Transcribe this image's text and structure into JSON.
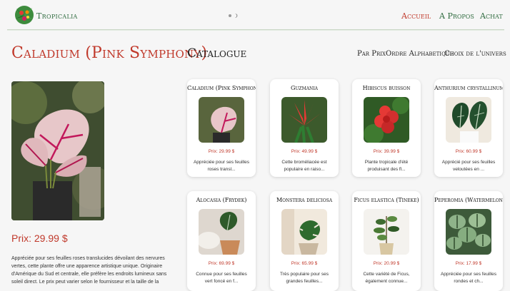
{
  "header": {
    "brand": "Tropicalia",
    "nav": [
      "Accueil",
      "A Propos",
      "Achat"
    ]
  },
  "product": {
    "title": "Caladium (Pink Symphony)",
    "price": "Prix: 29.99 $",
    "description": "Appréciée pour ses feuilles roses translucides dévoilant des nervures vertes, cette plante offre une apparence artistique unique. Originaire d'Amérique du Sud et centrale, elle préfère les endroits lumineux sans soleil direct. Le prix peut varier selon le fournisseur et la taille de la"
  },
  "catalogue": {
    "title": "Catalogue",
    "sort": [
      "Par Prix",
      "Ordre Alphabetique",
      "Choix de l'univers"
    ],
    "cards": [
      {
        "name": "Caladium (Pink Symphony)",
        "price": "Prix: 29.99 $",
        "desc1": "Appréciée pour ses feuilles",
        "desc2": "roses transl..."
      },
      {
        "name": "Guzmania",
        "price": "Prix: 49.99 $",
        "desc1": "Cette broméliacée est",
        "desc2": "populaire en raiso..."
      },
      {
        "name": "Hibiscus buisson",
        "price": "Prix: 39.99 $",
        "desc1": "Plante tropicale d'été",
        "desc2": "produisant des fl..."
      },
      {
        "name": "Anthurium crystallinum",
        "price": "Prix: 60.99 $",
        "desc1": "Apprécié pour ses feuilles",
        "desc2": "veloutées en ..."
      },
      {
        "name": "Alocasia (Frydek)",
        "price": "Prix: 69.99 $",
        "desc1": "Connue pour ses feuilles",
        "desc2": "vert foncé en f..."
      },
      {
        "name": "Monstera deliciosa",
        "price": "Prix: 65.99 $",
        "desc1": "Très populaire pour ses",
        "desc2": "grandes feuilles..."
      },
      {
        "name": "Ficus elastica (Tineke)",
        "price": "Prix: 20.99 $",
        "desc1": "Cette variété de Ficus,",
        "desc2": "également connue..."
      },
      {
        "name": "Peperomia (Watermelon)",
        "price": "Prix: 17.99 $",
        "desc1": "Appréciée pour ses feuilles",
        "desc2": "rondes et ch..."
      }
    ]
  },
  "colors": {
    "accent": "#c0392b",
    "brand": "#2f6b3f",
    "background": "#f6f6f6"
  }
}
